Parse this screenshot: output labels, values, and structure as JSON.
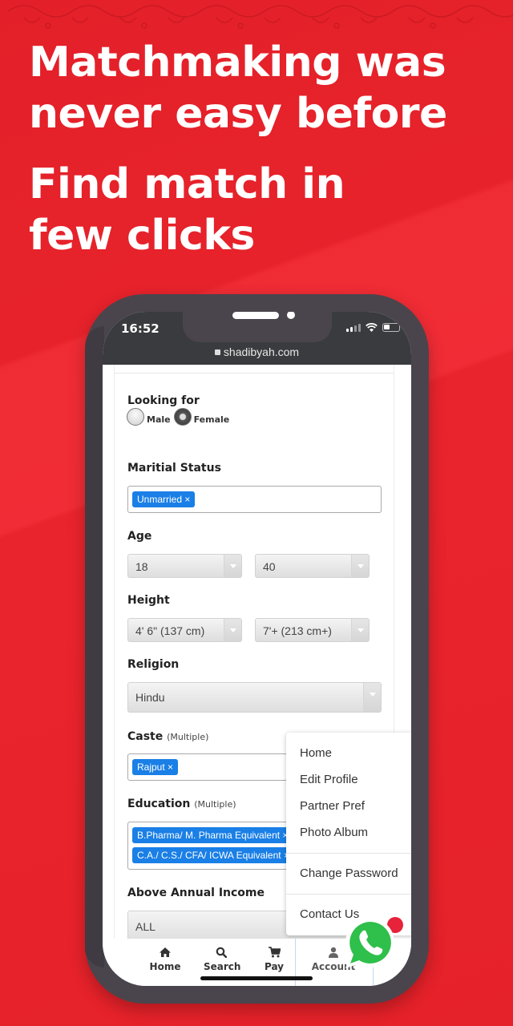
{
  "headline": {
    "line1": "Matchmaking was",
    "line2": "never easy before",
    "line3": "Find match in",
    "line4": "few clicks"
  },
  "colors": {
    "background": "#e8232b",
    "phone_frame": "#4a454d",
    "tag_blue": "#1a7fe6",
    "whatsapp_green": "#2fbf4b"
  },
  "statusbar": {
    "time": "16:52",
    "url": "shadibyah.com",
    "icons": [
      "signal-icon",
      "wifi-icon",
      "battery-icon"
    ]
  },
  "form": {
    "looking_for": {
      "label": "Looking for",
      "options": [
        {
          "label": "Male",
          "checked": false
        },
        {
          "label": "Female",
          "checked": true
        }
      ]
    },
    "marital_status": {
      "label": "Maritial Status",
      "tags": [
        "Unmarried"
      ],
      "remove_glyph": "×"
    },
    "age": {
      "label": "Age",
      "from": "18",
      "to": "40"
    },
    "height": {
      "label": "Height",
      "from": "4' 6\" (137 cm)",
      "to": "7'+ (213 cm+)"
    },
    "religion": {
      "label": "Religion",
      "value": "Hindu"
    },
    "caste": {
      "label": "Caste",
      "hint": "(Multiple)",
      "tags": [
        "Rajput"
      ]
    },
    "education": {
      "label": "Education",
      "hint": "(Multiple)",
      "tags": [
        "B.Pharma/ M. Pharma Equivalent",
        "C.A./ C.S./ CFA/ ICWA Equivalent"
      ]
    },
    "income": {
      "label": "Above Annual Income",
      "value": "ALL"
    }
  },
  "menu": {
    "items": [
      "Home",
      "Edit Profile",
      "Partner Pref",
      "Photo Album",
      "Change Password",
      "Contact Us"
    ]
  },
  "bottom_nav": {
    "items": [
      {
        "label": "Home",
        "icon": "home-icon"
      },
      {
        "label": "Search",
        "icon": "search-icon"
      },
      {
        "label": "Pay",
        "icon": "cart-icon"
      },
      {
        "label": "Account",
        "icon": "user-icon"
      }
    ]
  },
  "whatsapp": {
    "icon": "whatsapp-icon"
  }
}
